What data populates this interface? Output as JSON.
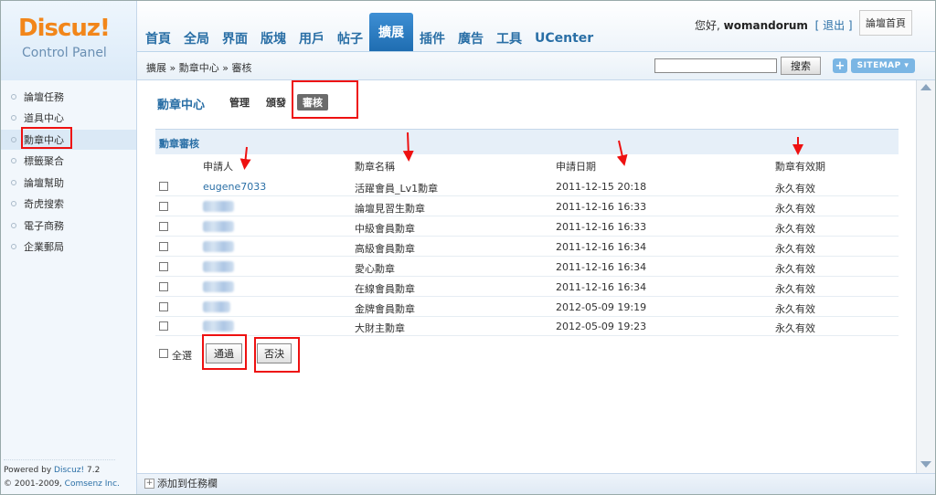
{
  "logo": {
    "brand": "Discuz!",
    "subtitle": "Control Panel"
  },
  "nav": {
    "tabs": [
      "首頁",
      "全局",
      "界面",
      "版塊",
      "用戶",
      "帖子",
      "擴展",
      "插件",
      "廣告",
      "工具",
      "UCenter"
    ],
    "active": "擴展"
  },
  "user": {
    "greeting": "您好,",
    "name": "womandorum",
    "logout": "[ 退出 ]",
    "home": "論壇首頁"
  },
  "breadcrumb": "擴展 » 勳章中心 » 審核",
  "search": {
    "value": "",
    "button": "搜索"
  },
  "sitemap": {
    "plus": "+",
    "label": "SITEMAP"
  },
  "sidebar": {
    "items": [
      "論壇任務",
      "道具中心",
      "勳章中心",
      "標籤聚合",
      "論壇幫助",
      "奇虎搜索",
      "電子商務",
      "企業郵局"
    ],
    "active": "勳章中心"
  },
  "sidebar_footer": {
    "powered_prefix": "Powered by",
    "powered_link": "Discuz!",
    "version": "7.2",
    "copyright": "© 2001-2009,",
    "company": "Comsenz Inc."
  },
  "main": {
    "title": "勳章中心",
    "subtabs": [
      "管理",
      "頒發",
      "審核"
    ],
    "active_subtab": "審核",
    "section_title": "勳章審核",
    "columns": [
      "申請人",
      "勳章名稱",
      "申請日期",
      "勳章有效期"
    ],
    "rows": [
      {
        "applicant": "eugene7033",
        "medal": "活躍會員_Lv1勳章",
        "date": "2011-12-15 20:18",
        "validity": "永久有效",
        "blurred": false
      },
      {
        "applicant": "",
        "medal": "論壇見習生勳章",
        "date": "2011-12-16 16:33",
        "validity": "永久有效",
        "blurred": true
      },
      {
        "applicant": "",
        "medal": "中級會員勳章",
        "date": "2011-12-16 16:33",
        "validity": "永久有效",
        "blurred": true
      },
      {
        "applicant": "",
        "medal": "高級會員勳章",
        "date": "2011-12-16 16:34",
        "validity": "永久有效",
        "blurred": true
      },
      {
        "applicant": "",
        "medal": "愛心勳章",
        "date": "2011-12-16 16:34",
        "validity": "永久有效",
        "blurred": true
      },
      {
        "applicant": "",
        "medal": "在線會員勳章",
        "date": "2011-12-16 16:34",
        "validity": "永久有效",
        "blurred": true
      },
      {
        "applicant": "",
        "medal": "金牌會員勳章",
        "date": "2012-05-09 19:19",
        "validity": "永久有效",
        "blurred": true
      },
      {
        "applicant": "",
        "medal": "大財主勳章",
        "date": "2012-05-09 19:23",
        "validity": "永久有效",
        "blurred": true
      }
    ],
    "select_all": "全選",
    "approve": "通過",
    "reject": "否決"
  },
  "statusbar": {
    "add_task": "添加到任務欄",
    "add_icon": "+"
  },
  "colors": {
    "accent": "#2a6fa6",
    "nav_active": "#1f6db1",
    "logo_orange": "#f2861a",
    "highlight": "#e11111"
  }
}
